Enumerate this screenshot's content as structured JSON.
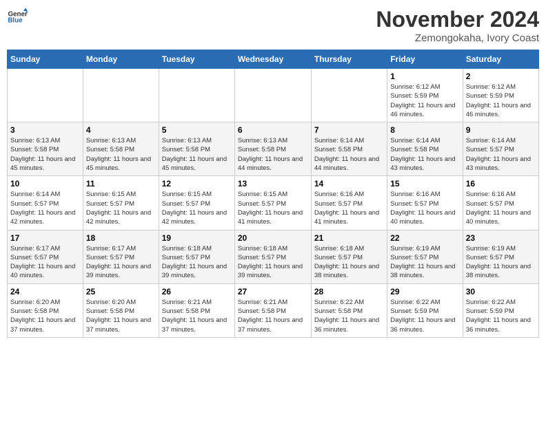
{
  "logo": {
    "line1": "General",
    "line2": "Blue"
  },
  "title": "November 2024",
  "subtitle": "Zemongokaha, Ivory Coast",
  "days_of_week": [
    "Sunday",
    "Monday",
    "Tuesday",
    "Wednesday",
    "Thursday",
    "Friday",
    "Saturday"
  ],
  "weeks": [
    [
      {
        "day": "",
        "info": ""
      },
      {
        "day": "",
        "info": ""
      },
      {
        "day": "",
        "info": ""
      },
      {
        "day": "",
        "info": ""
      },
      {
        "day": "",
        "info": ""
      },
      {
        "day": "1",
        "info": "Sunrise: 6:12 AM\nSunset: 5:59 PM\nDaylight: 11 hours and 46 minutes."
      },
      {
        "day": "2",
        "info": "Sunrise: 6:12 AM\nSunset: 5:59 PM\nDaylight: 11 hours and 46 minutes."
      }
    ],
    [
      {
        "day": "3",
        "info": "Sunrise: 6:13 AM\nSunset: 5:58 PM\nDaylight: 11 hours and 45 minutes."
      },
      {
        "day": "4",
        "info": "Sunrise: 6:13 AM\nSunset: 5:58 PM\nDaylight: 11 hours and 45 minutes."
      },
      {
        "day": "5",
        "info": "Sunrise: 6:13 AM\nSunset: 5:58 PM\nDaylight: 11 hours and 45 minutes."
      },
      {
        "day": "6",
        "info": "Sunrise: 6:13 AM\nSunset: 5:58 PM\nDaylight: 11 hours and 44 minutes."
      },
      {
        "day": "7",
        "info": "Sunrise: 6:14 AM\nSunset: 5:58 PM\nDaylight: 11 hours and 44 minutes."
      },
      {
        "day": "8",
        "info": "Sunrise: 6:14 AM\nSunset: 5:58 PM\nDaylight: 11 hours and 43 minutes."
      },
      {
        "day": "9",
        "info": "Sunrise: 6:14 AM\nSunset: 5:57 PM\nDaylight: 11 hours and 43 minutes."
      }
    ],
    [
      {
        "day": "10",
        "info": "Sunrise: 6:14 AM\nSunset: 5:57 PM\nDaylight: 11 hours and 42 minutes."
      },
      {
        "day": "11",
        "info": "Sunrise: 6:15 AM\nSunset: 5:57 PM\nDaylight: 11 hours and 42 minutes."
      },
      {
        "day": "12",
        "info": "Sunrise: 6:15 AM\nSunset: 5:57 PM\nDaylight: 11 hours and 42 minutes."
      },
      {
        "day": "13",
        "info": "Sunrise: 6:15 AM\nSunset: 5:57 PM\nDaylight: 11 hours and 41 minutes."
      },
      {
        "day": "14",
        "info": "Sunrise: 6:16 AM\nSunset: 5:57 PM\nDaylight: 11 hours and 41 minutes."
      },
      {
        "day": "15",
        "info": "Sunrise: 6:16 AM\nSunset: 5:57 PM\nDaylight: 11 hours and 40 minutes."
      },
      {
        "day": "16",
        "info": "Sunrise: 6:16 AM\nSunset: 5:57 PM\nDaylight: 11 hours and 40 minutes."
      }
    ],
    [
      {
        "day": "17",
        "info": "Sunrise: 6:17 AM\nSunset: 5:57 PM\nDaylight: 11 hours and 40 minutes."
      },
      {
        "day": "18",
        "info": "Sunrise: 6:17 AM\nSunset: 5:57 PM\nDaylight: 11 hours and 39 minutes."
      },
      {
        "day": "19",
        "info": "Sunrise: 6:18 AM\nSunset: 5:57 PM\nDaylight: 11 hours and 39 minutes."
      },
      {
        "day": "20",
        "info": "Sunrise: 6:18 AM\nSunset: 5:57 PM\nDaylight: 11 hours and 39 minutes."
      },
      {
        "day": "21",
        "info": "Sunrise: 6:18 AM\nSunset: 5:57 PM\nDaylight: 11 hours and 38 minutes."
      },
      {
        "day": "22",
        "info": "Sunrise: 6:19 AM\nSunset: 5:57 PM\nDaylight: 11 hours and 38 minutes."
      },
      {
        "day": "23",
        "info": "Sunrise: 6:19 AM\nSunset: 5:57 PM\nDaylight: 11 hours and 38 minutes."
      }
    ],
    [
      {
        "day": "24",
        "info": "Sunrise: 6:20 AM\nSunset: 5:58 PM\nDaylight: 11 hours and 37 minutes."
      },
      {
        "day": "25",
        "info": "Sunrise: 6:20 AM\nSunset: 5:58 PM\nDaylight: 11 hours and 37 minutes."
      },
      {
        "day": "26",
        "info": "Sunrise: 6:21 AM\nSunset: 5:58 PM\nDaylight: 11 hours and 37 minutes."
      },
      {
        "day": "27",
        "info": "Sunrise: 6:21 AM\nSunset: 5:58 PM\nDaylight: 11 hours and 37 minutes."
      },
      {
        "day": "28",
        "info": "Sunrise: 6:22 AM\nSunset: 5:58 PM\nDaylight: 11 hours and 36 minutes."
      },
      {
        "day": "29",
        "info": "Sunrise: 6:22 AM\nSunset: 5:59 PM\nDaylight: 11 hours and 36 minutes."
      },
      {
        "day": "30",
        "info": "Sunrise: 6:22 AM\nSunset: 5:59 PM\nDaylight: 11 hours and 36 minutes."
      }
    ]
  ]
}
